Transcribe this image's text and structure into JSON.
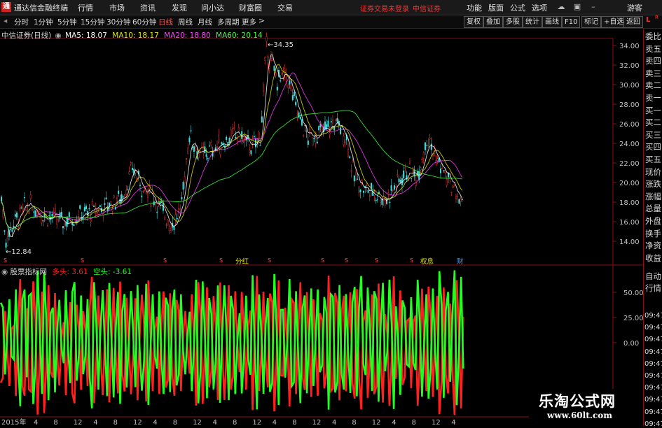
{
  "window": {
    "title": "通达信金融终端",
    "menu": [
      "行情",
      "市场",
      "资讯",
      "发现",
      "问小达",
      "财富圈",
      "交易"
    ],
    "notice": "证券交易未登录",
    "broker": "中信证券",
    "right_menu": [
      "功能",
      "版面",
      "公式",
      "选项"
    ],
    "guest": "游客"
  },
  "toolbar": {
    "periods": [
      "分时",
      "1分钟",
      "5分钟",
      "15分钟",
      "30分钟",
      "60分钟",
      "日线",
      "周线",
      "月线",
      "多周期",
      "更多"
    ],
    "active_period": "日线",
    "more_arrow": ">",
    "right_buttons": [
      "复权",
      "叠加",
      "多股",
      "统计",
      "画线",
      "F10",
      "标记",
      "+自选",
      "返回"
    ]
  },
  "main_chart": {
    "stock": "中信证券(日线)",
    "ma": [
      {
        "label": "MA5: 18.07",
        "color": "#ffffff"
      },
      {
        "label": "MA10: 18.17",
        "color": "#e6e600"
      },
      {
        "label": "MA20: 18.80",
        "color": "#ff40ff"
      },
      {
        "label": "MA60: 20.14",
        "color": "#40ff40"
      }
    ],
    "high_label": "34.35",
    "low_label": "12.84",
    "y_ticks": [
      "34.00",
      "32.00",
      "30.00",
      "28.00",
      "26.00",
      "24.00",
      "22.00",
      "20.00",
      "18.00",
      "16.00",
      "14.00"
    ],
    "markers": [
      "分红",
      "权息",
      "财"
    ]
  },
  "sub_chart": {
    "name": "股票指标网",
    "long_label": "多头: 3.61",
    "short_label": "空头: -3.61",
    "long_color": "#ff2020",
    "short_color": "#20ff20",
    "y_ticks": [
      "50.00",
      "25.00",
      "0.00"
    ]
  },
  "x_axis": {
    "start": "2015年",
    "ticks": [
      "4",
      "8",
      "12",
      "4",
      "8",
      "12",
      "4",
      "8",
      "12",
      "4",
      "8",
      "12",
      "4",
      "8",
      "12",
      "4",
      "8",
      "12",
      "4",
      "8",
      "12",
      "4"
    ]
  },
  "side_panel": {
    "top": [
      "L",
      "R"
    ],
    "items": [
      "委比",
      "卖五",
      "卖四",
      "卖三",
      "卖二",
      "卖一",
      "买一",
      "买二",
      "买三",
      "买四",
      "买五",
      "现价",
      "涨跌",
      "涨幅",
      "总量",
      "外盘",
      "换手",
      "净资",
      "收益"
    ],
    "lower": [
      "自动",
      "行情"
    ],
    "times": [
      "09:47",
      "09:47",
      "09:47",
      "09:47",
      "09:47",
      "09:47",
      "09:47",
      "09:47",
      "09:47",
      "09:47"
    ]
  },
  "watermark": {
    "title": "乐淘公式网",
    "url": "www.60lt.com"
  }
}
